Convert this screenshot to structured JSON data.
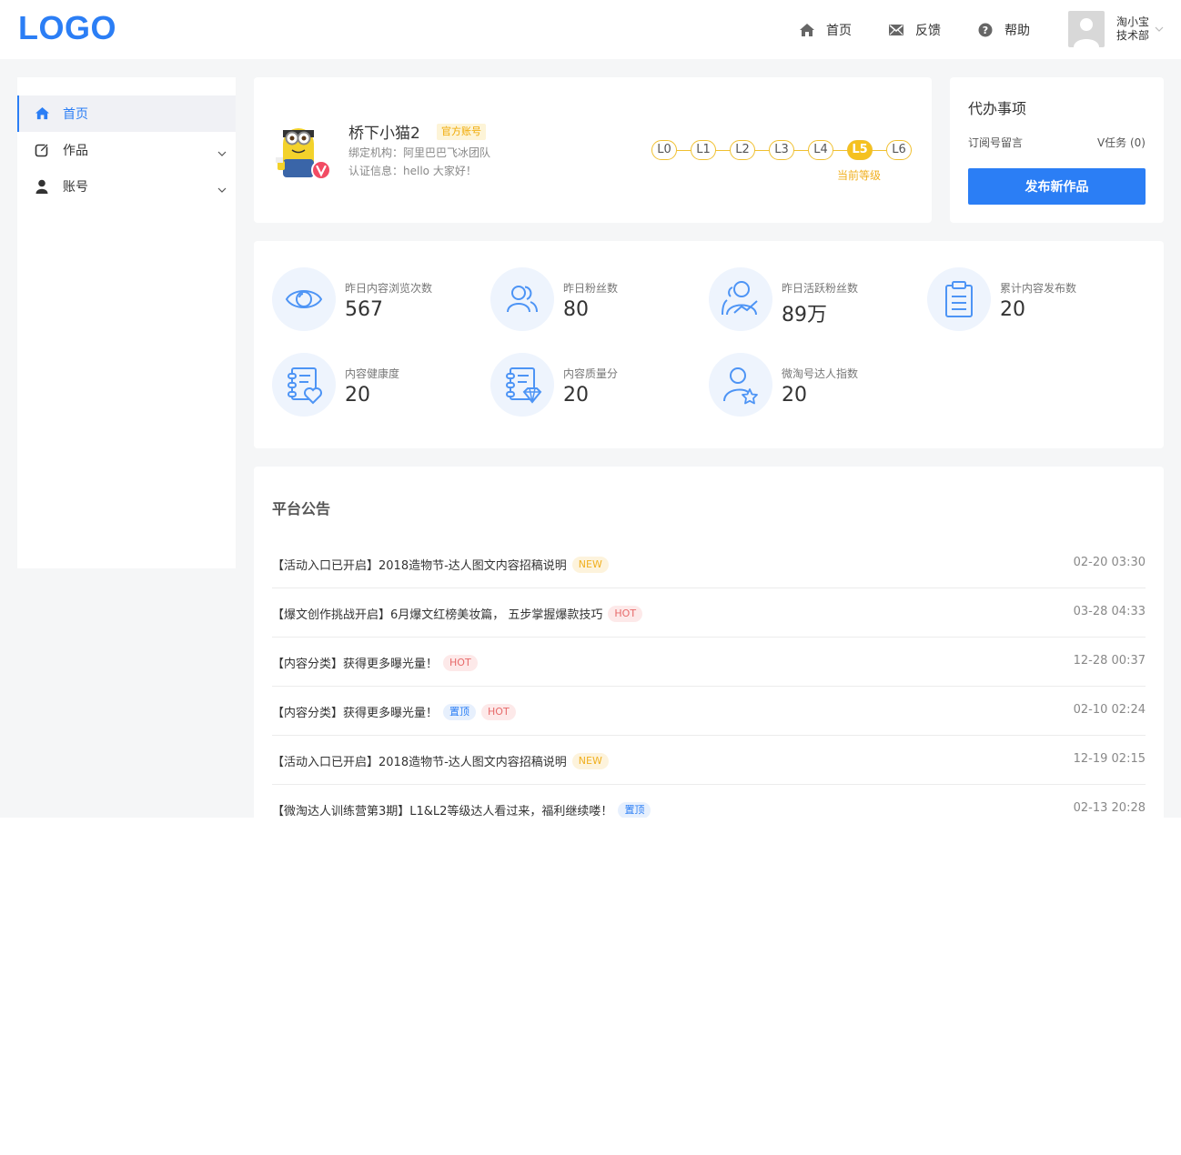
{
  "header": {
    "logo": "LOGO",
    "nav": [
      {
        "label": "首页",
        "icon": "home-icon"
      },
      {
        "label": "反馈",
        "icon": "mail-icon"
      },
      {
        "label": "帮助",
        "icon": "help-icon"
      }
    ],
    "user": {
      "name": "淘小宝",
      "dept": "技术部"
    }
  },
  "sidebar": {
    "items": [
      {
        "label": "首页",
        "icon": "home-icon",
        "active": true
      },
      {
        "label": "作品",
        "icon": "edit-icon",
        "active": false
      },
      {
        "label": "账号",
        "icon": "user-icon",
        "active": false
      }
    ]
  },
  "profile": {
    "name": "桥下小猫2",
    "badge": "官方账号",
    "org": "绑定机构：阿里巴巴飞冰团队",
    "cert": "认证信息：hello 大家好！",
    "levels": [
      "L0",
      "L1",
      "L2",
      "L3",
      "L4",
      "L5",
      "L6"
    ],
    "current_level": "L5",
    "current_level_text": "当前等级"
  },
  "todo": {
    "title": "代办事项",
    "row_label": "订阅号留言",
    "row_value": "V任务 (0)",
    "publish_button": "发布新作品"
  },
  "stats": [
    {
      "label": "昨日内容浏览次数",
      "value": "567",
      "icon": "eye-icon"
    },
    {
      "label": "昨日粉丝数",
      "value": "80",
      "icon": "fans-icon"
    },
    {
      "label": "昨日活跃粉丝数",
      "value": "89万",
      "icon": "active-fans-icon"
    },
    {
      "label": "累计内容发布数",
      "value": "20",
      "icon": "clipboard-icon"
    },
    {
      "label": "内容健康度",
      "value": "20",
      "icon": "health-icon"
    },
    {
      "label": "内容质量分",
      "value": "20",
      "icon": "quality-icon"
    },
    {
      "label": "微淘号达人指数",
      "value": "20",
      "icon": "star-user-icon"
    }
  ],
  "notice": {
    "title": "平台公告",
    "items": [
      {
        "text": "【活动入口已开启】2018造物节-达人图文内容招稿说明",
        "tags": [
          "NEW"
        ],
        "time": "02-20 03:30"
      },
      {
        "text": "【爆文创作挑战开启】6月爆文红榜美妆篇， 五步掌握爆款技巧",
        "tags": [
          "HOT"
        ],
        "time": "03-28 04:33"
      },
      {
        "text": "【内容分类】获得更多曝光量！",
        "tags": [
          "HOT"
        ],
        "time": "12-28 00:37"
      },
      {
        "text": "【内容分类】获得更多曝光量！",
        "tags": [
          "置顶",
          "HOT"
        ],
        "time": "02-10 02:24"
      },
      {
        "text": "【活动入口已开启】2018造物节-达人图文内容招稿说明",
        "tags": [
          "NEW"
        ],
        "time": "12-19 02:15"
      },
      {
        "text": "【微淘达人训练营第3期】L1&L2等级达人看过来，福利继续喽！",
        "tags": [
          "置顶"
        ],
        "time": "02-13 20:28"
      }
    ]
  },
  "colors": {
    "accent": "#2b7ef5",
    "level": "#f5c11f",
    "bg": "#f5f6f7"
  }
}
